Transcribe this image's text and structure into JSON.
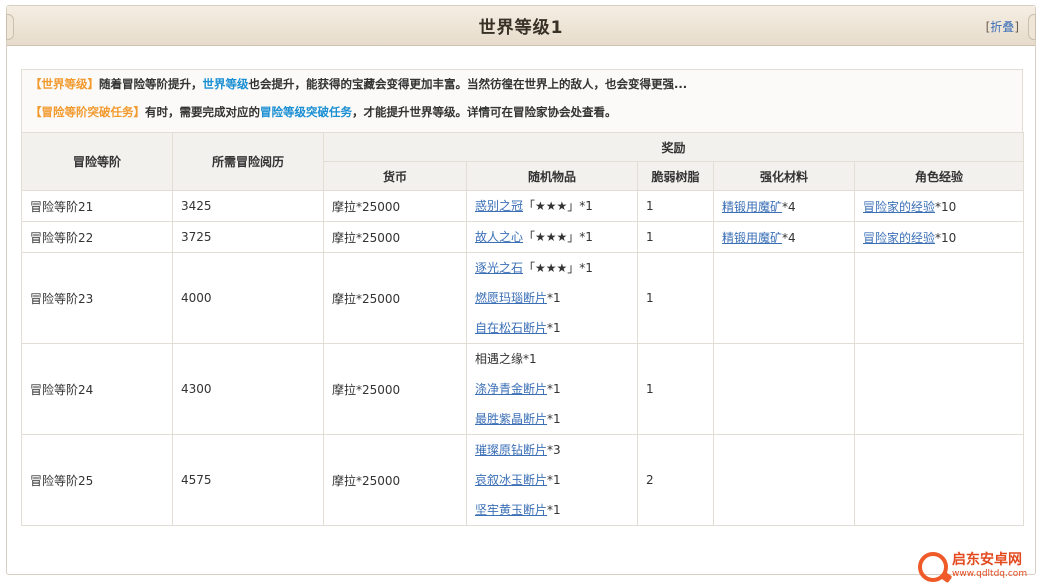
{
  "panel": {
    "title": "世界等级1",
    "collapse_label": "折叠"
  },
  "intro": {
    "line1": {
      "tag": "【世界等级】",
      "part1": "随着冒险等阶提升，",
      "link": "世界等级",
      "part2": "也会提升，能获得的宝藏会变得更加丰富。当然彷徨在世界上的敌人，也会变得更强..."
    },
    "line2": {
      "tag": "【冒险等阶突破任务】",
      "part1": "有时，需要完成对应的",
      "link": "冒险等级突破任务",
      "part2": "，才能提升世界等级。详情可在冒险家协会处查看。"
    }
  },
  "table": {
    "headers": {
      "rank": "冒险等阶",
      "exp": "所需冒险阅历",
      "reward": "奖励",
      "currency": "货币",
      "random": "随机物品",
      "resin": "脆弱树脂",
      "material": "强化材料",
      "char_exp": "角色经验"
    },
    "rows": [
      {
        "rank": "冒险等阶21",
        "exp": "3425",
        "currency": "摩拉*25000",
        "items": [
          {
            "link": "惑别之冠",
            "suffix": "「★★★」*1"
          }
        ],
        "resin": "1",
        "material_link": "精锻用魔矿",
        "material_suffix": "*4",
        "charexp_link": "冒险家的经验",
        "charexp_suffix": "*10"
      },
      {
        "rank": "冒险等阶22",
        "exp": "3725",
        "currency": "摩拉*25000",
        "items": [
          {
            "link": "故人之心",
            "suffix": "「★★★」*1"
          }
        ],
        "resin": "1",
        "material_link": "精锻用魔矿",
        "material_suffix": "*4",
        "charexp_link": "冒险家的经验",
        "charexp_suffix": "*10"
      },
      {
        "rank": "冒险等阶23",
        "exp": "4000",
        "currency": "摩拉*25000",
        "items": [
          {
            "link": "逐光之石",
            "suffix": "「★★★」*1"
          },
          {
            "link": "燃愿玛瑙断片",
            "suffix": "*1"
          },
          {
            "link": "自在松石断片",
            "suffix": "*1"
          }
        ],
        "resin": "1",
        "material_link": "",
        "material_suffix": "",
        "charexp_link": "",
        "charexp_suffix": ""
      },
      {
        "rank": "冒险等阶24",
        "exp": "4300",
        "currency": "摩拉*25000",
        "items": [
          {
            "link": "",
            "suffix": "相遇之缘*1"
          },
          {
            "link": "涤净青金断片",
            "suffix": "*1"
          },
          {
            "link": "最胜紫晶断片",
            "suffix": "*1"
          }
        ],
        "resin": "1",
        "material_link": "",
        "material_suffix": "",
        "charexp_link": "",
        "charexp_suffix": ""
      },
      {
        "rank": "冒险等阶25",
        "exp": "4575",
        "currency": "摩拉*25000",
        "items": [
          {
            "link": "璀璨原钻断片",
            "suffix": "*3"
          },
          {
            "link": "哀叙冰玉断片",
            "suffix": "*1"
          },
          {
            "link": "坚牢黄玉断片",
            "suffix": "*1"
          }
        ],
        "resin": "2",
        "material_link": "",
        "material_suffix": "",
        "charexp_link": "",
        "charexp_suffix": ""
      }
    ]
  },
  "watermark": {
    "name": "启东安卓网",
    "url": "www.qdltdq.com"
  }
}
